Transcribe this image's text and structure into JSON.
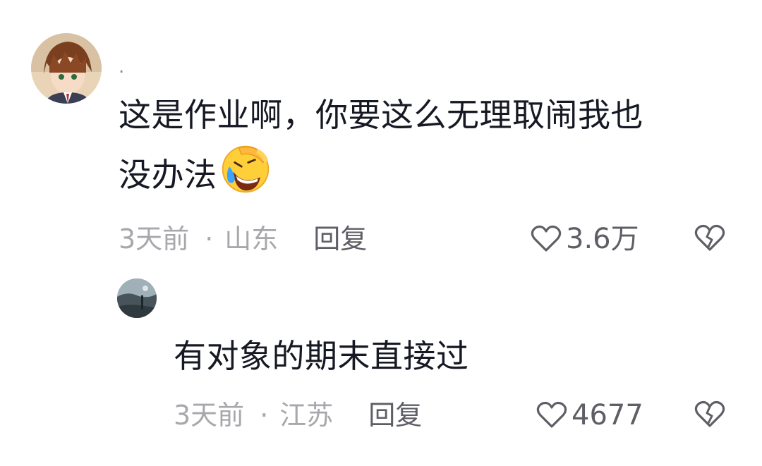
{
  "comments": [
    {
      "username": ".",
      "text_line1": "这是作业啊，你要这么无理取闹我也",
      "text_line2": "没办法",
      "emoji": "rolling-on-floor-laughing-emoji",
      "time": "3天前",
      "separator": "·",
      "location": "山东",
      "reply_label": "回复",
      "like_count": "3.6万"
    },
    {
      "username": "",
      "text": "有对象的期末直接过",
      "time": "3天前",
      "separator": "·",
      "location": "江苏",
      "reply_label": "回复",
      "like_count": "4677"
    }
  ],
  "colors": {
    "text": "#161823",
    "meta": "#a7a8ac",
    "action": "#5e5f66"
  }
}
